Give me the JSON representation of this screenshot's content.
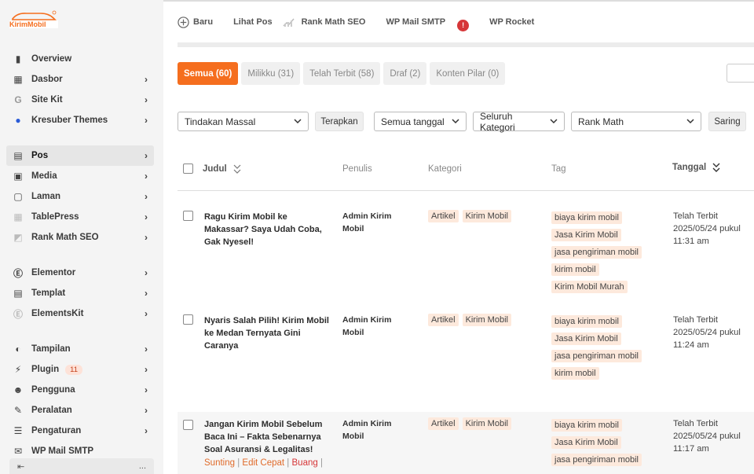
{
  "brand": {
    "logo_text": "KirimMobil"
  },
  "sidebar": {
    "items": [
      {
        "label": "Overview",
        "icon": "chart-bar-icon",
        "chevron": false
      },
      {
        "label": "Dasbor",
        "icon": "dashboard-icon",
        "chevron": true
      },
      {
        "label": "Site Kit",
        "icon": "google-g-icon",
        "chevron": true
      },
      {
        "label": "Kresuber Themes",
        "icon": "themes-circle-icon",
        "chevron": true
      },
      {
        "label": "Pos",
        "icon": "post-icon",
        "chevron": true,
        "active": true
      },
      {
        "label": "Media",
        "icon": "media-icon",
        "chevron": true
      },
      {
        "label": "Laman",
        "icon": "page-icon",
        "chevron": true
      },
      {
        "label": "TablePress",
        "icon": "table-icon",
        "chevron": true
      },
      {
        "label": "Rank Math SEO",
        "icon": "rankmath-icon",
        "chevron": true
      },
      {
        "label": "Elementor",
        "icon": "elementor-icon",
        "chevron": true
      },
      {
        "label": "Templat",
        "icon": "template-icon",
        "chevron": true
      },
      {
        "label": "ElementsKit",
        "icon": "elementskit-icon",
        "chevron": true
      },
      {
        "label": "Tampilan",
        "icon": "appearance-icon",
        "chevron": true
      },
      {
        "label": "Plugin",
        "icon": "plugin-icon",
        "chevron": true,
        "badge": "11"
      },
      {
        "label": "Pengguna",
        "icon": "users-icon",
        "chevron": true
      },
      {
        "label": "Peralatan",
        "icon": "tools-icon",
        "chevron": true
      },
      {
        "label": "Pengaturan",
        "icon": "settings-icon",
        "chevron": true
      },
      {
        "label": "WP Mail SMTP",
        "icon": "mail-icon",
        "chevron": false
      }
    ],
    "collapse_dots": "..."
  },
  "toolbar": {
    "new_label": "Baru",
    "view_posts_label": "Lihat Pos",
    "rank_math_label": "Rank Math SEO",
    "smtp_label": "WP Mail SMTP",
    "smtp_alert": "!",
    "rocket_label": "WP Rocket"
  },
  "filters": [
    {
      "label": "Semua (60)",
      "active": true
    },
    {
      "label": "Milikku (31)"
    },
    {
      "label": "Telah Terbit (58)"
    },
    {
      "label": "Draf (2)"
    },
    {
      "label": "Konten Pilar (0)"
    }
  ],
  "bulk": {
    "action_select": "Tindakan Massal",
    "apply_label": "Terapkan",
    "date_select": "Semua tanggal",
    "category_select": "Seluruh Kategori",
    "rankmath_select": "Rank Math",
    "filter_label": "Saring"
  },
  "columns": {
    "title": "Judul",
    "author": "Penulis",
    "category": "Kategori",
    "tag": "Tag",
    "date": "Tanggal"
  },
  "posts": [
    {
      "title": "Ragu Kirim Mobil ke Makassar? Saya Udah Coba, Gak Nyesel!",
      "author": "Admin Kirim Mobil",
      "categories": [
        "Artikel",
        "Kirim Mobil"
      ],
      "tags": [
        "biaya kirim mobil",
        "Jasa Kirim Mobil",
        "jasa pengiriman mobil",
        "kirim mobil",
        "Kirim Mobil Murah"
      ],
      "status": "Telah Terbit",
      "date": "2025/05/24 pukul 11:31 am"
    },
    {
      "title": "Nyaris Salah Pilih! Kirim Mobil ke Medan Ternyata Gini Caranya",
      "author": "Admin Kirim Mobil",
      "categories": [
        "Artikel",
        "Kirim Mobil"
      ],
      "tags": [
        "biaya kirim mobil",
        "Jasa Kirim Mobil",
        "jasa pengiriman mobil",
        "kirim mobil"
      ],
      "status": "Telah Terbit",
      "date": "2025/05/24 pukul 11:24 am"
    },
    {
      "title": "Jangan Kirim Mobil Sebelum Baca Ini – Fakta Sebenarnya Soal Asuransi & Legalitas!",
      "author": "Admin Kirim Mobil",
      "categories": [
        "Artikel",
        "Kirim Mobil"
      ],
      "tags": [
        "biaya kirim mobil",
        "Jasa Kirim Mobil",
        "jasa pengiriman mobil"
      ],
      "status": "Telah Terbit",
      "date": "2025/05/24 pukul 11:17 am",
      "row_actions": {
        "edit": "Sunting",
        "quick_edit": "Edit Cepat",
        "trash": "Buang"
      }
    }
  ],
  "colors": {
    "accent": "#f56e1e",
    "chip_bg": "#fde9dc",
    "sidebar_bg": "#f4f4f4",
    "alert": "#d63638"
  }
}
